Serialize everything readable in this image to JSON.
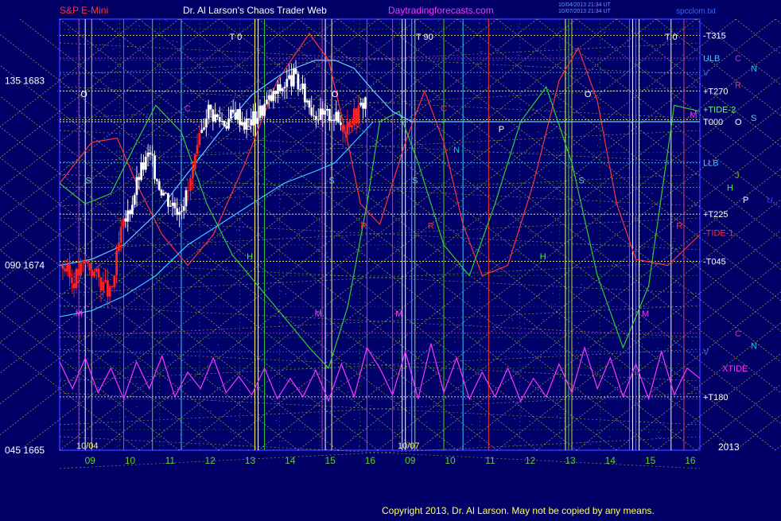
{
  "header": {
    "instrument": "S&P E-Mini",
    "site": "Dr. Al Larson's Chaos Trader Web",
    "url": "Daytradingforecasts.com",
    "stamp_line1": "10/04/2013 21:34 UT",
    "stamp_line2": "10/07/2013 21:34 UT",
    "file": "spcclom.txt"
  },
  "footer": {
    "copyright": "Copyright 2013, Dr. Al Larson. May not be copied by any means."
  },
  "chart_data": {
    "type": "line",
    "title": "Dr. Al Larson's Chaos Trader Web",
    "y_axis": {
      "ylim": [
        1665,
        1686
      ],
      "ticks": [
        {
          "value": 1683,
          "label": "135  1683"
        },
        {
          "value": 1674,
          "label": "090  1674"
        },
        {
          "value": 1665,
          "label": "045  1665"
        }
      ]
    },
    "x_axis": {
      "hour_labels": [
        "09",
        "10",
        "11",
        "12",
        "13",
        "14",
        "15",
        "16",
        "09",
        "10",
        "11",
        "12",
        "13",
        "14",
        "15",
        "16"
      ],
      "date_labels": [
        "10/04",
        "10/07"
      ],
      "year_label": "2013"
    },
    "right_labels": [
      {
        "text": "-T315",
        "color": "#ffffff",
        "value": 1685.2
      },
      {
        "text": "ULB",
        "color": "#33ccff",
        "value": 1684.1
      },
      {
        "text": "C",
        "color": "#cc33cc",
        "value": 1684.1,
        "col": 2
      },
      {
        "text": "N",
        "color": "#00cccc",
        "value": 1683.6,
        "col": 3
      },
      {
        "text": "V",
        "color": "#3366ff",
        "value": 1683.4
      },
      {
        "text": "R",
        "color": "#ff3333",
        "value": 1682.8,
        "col": 2
      },
      {
        "text": "+T270",
        "color": "#ffffff",
        "value": 1682.5
      },
      {
        "text": "+TIDE-2",
        "color": "#66ff66",
        "value": 1681.6
      },
      {
        "text": "S",
        "color": "#66cccc",
        "value": 1681.2,
        "col": 3
      },
      {
        "text": "T000",
        "color": "#ffffff",
        "value": 1681.0
      },
      {
        "text": "O",
        "color": "#ffffff",
        "value": 1681.0,
        "col": 2
      },
      {
        "text": "LLB",
        "color": "#33ccff",
        "value": 1679.0
      },
      {
        "text": "J",
        "color": "#66cc00",
        "value": 1678.4,
        "col": 2
      },
      {
        "text": "H",
        "color": "#33ff33",
        "value": 1677.8,
        "col": 1.5
      },
      {
        "text": "P",
        "color": "#ffffff",
        "value": 1677.2,
        "col": 2.5
      },
      {
        "text": "U",
        "color": "#3333ff",
        "value": 1677.2,
        "col": 4
      },
      {
        "text": "+T225",
        "color": "#ffffff",
        "value": 1676.5
      },
      {
        "text": "-TIDE-1",
        "color": "#ff3333",
        "value": 1675.6
      },
      {
        "text": "-T045",
        "color": "#ffffff",
        "value": 1674.2
      },
      {
        "text": "C",
        "color": "#cc33cc",
        "value": 1670.7,
        "col": 2
      },
      {
        "text": "N",
        "color": "#00cccc",
        "value": 1670.1,
        "col": 3
      },
      {
        "text": "V",
        "color": "#3366ff",
        "value": 1669.8
      },
      {
        "text": "XTIDE",
        "color": "#ff33ff",
        "value": 1669.0,
        "col": 1.2
      },
      {
        "text": "+T180",
        "color": "#ffffff",
        "value": 1667.6
      }
    ],
    "plot_letters": [
      {
        "text": "T  0",
        "color": "#ffffff",
        "x": 0.275,
        "value": 1685.0
      },
      {
        "text": "T  90",
        "color": "#ffffff",
        "x": 0.57,
        "value": 1685.0
      },
      {
        "text": "T  0",
        "color": "#ffffff",
        "x": 0.955,
        "value": 1685.0
      },
      {
        "text": "O",
        "color": "#ffffff",
        "x": 0.038,
        "value": 1682.2
      },
      {
        "text": "O",
        "color": "#ffffff",
        "x": 0.43,
        "value": 1682.2
      },
      {
        "text": "O",
        "color": "#ffffff",
        "x": 0.825,
        "value": 1682.2
      },
      {
        "text": "P",
        "color": "#ffffff",
        "x": 0.295,
        "value": 1680.5
      },
      {
        "text": "P",
        "color": "#ffffff",
        "x": 0.69,
        "value": 1680.5
      },
      {
        "text": "C",
        "color": "#cc33cc",
        "x": 0.2,
        "value": 1681.5
      },
      {
        "text": "C",
        "color": "#ff3333",
        "x": 0.6,
        "value": 1681.5
      },
      {
        "text": "N",
        "color": "#00cccc",
        "x": 0.62,
        "value": 1679.5
      },
      {
        "text": "S",
        "color": "#66cccc",
        "x": 0.045,
        "value": 1678.0
      },
      {
        "text": "S",
        "color": "#66cccc",
        "x": 0.425,
        "value": 1678.0
      },
      {
        "text": "S",
        "color": "#66cccc",
        "x": 0.555,
        "value": 1678.0
      },
      {
        "text": "S",
        "color": "#66cccc",
        "x": 0.815,
        "value": 1678.0
      },
      {
        "text": "R",
        "color": "#ff3333",
        "x": 0.475,
        "value": 1675.8
      },
      {
        "text": "R",
        "color": "#ff3333",
        "x": 0.58,
        "value": 1675.8
      },
      {
        "text": "R",
        "color": "#ff3333",
        "x": 0.968,
        "value": 1675.8
      },
      {
        "text": "H",
        "color": "#33ff33",
        "x": 0.297,
        "value": 1674.3
      },
      {
        "text": "H",
        "color": "#33ff33",
        "x": 0.755,
        "value": 1674.3
      },
      {
        "text": "M",
        "color": "#ff33ff",
        "x": 0.03,
        "value": 1671.5
      },
      {
        "text": "M",
        "color": "#ff33ff",
        "x": 0.404,
        "value": 1671.5
      },
      {
        "text": "M",
        "color": "#ff33ff",
        "x": 0.53,
        "value": 1671.5
      },
      {
        "text": "M",
        "color": "#ff33ff",
        "x": 0.915,
        "value": 1671.5
      },
      {
        "text": "M",
        "color": "#ff33ff",
        "x": 0.99,
        "value": 1681.2
      }
    ],
    "vertical_lines": [
      {
        "x": 0.03,
        "color": "#cc33cc"
      },
      {
        "x": 0.04,
        "color": "#ffffff"
      },
      {
        "x": 0.05,
        "color": "#cccc33"
      },
      {
        "x": 0.1,
        "color": "#ff3333"
      },
      {
        "x": 0.145,
        "color": "#66cc00"
      },
      {
        "x": 0.19,
        "color": "#33ccff"
      },
      {
        "x": 0.305,
        "color": "#ffff66"
      },
      {
        "x": 0.31,
        "color": "#ffffff"
      },
      {
        "x": 0.32,
        "color": "#33cc33"
      },
      {
        "x": 0.41,
        "color": "#cc33cc"
      },
      {
        "x": 0.415,
        "color": "#ffffff"
      },
      {
        "x": 0.425,
        "color": "#ffff66"
      },
      {
        "x": 0.48,
        "color": "#cc33cc"
      },
      {
        "x": 0.52,
        "color": "#ff3333"
      },
      {
        "x": 0.535,
        "color": "#ffffff"
      },
      {
        "x": 0.54,
        "color": "#ffffff"
      },
      {
        "x": 0.55,
        "color": "#33ccff"
      },
      {
        "x": 0.555,
        "color": "#cccc33"
      },
      {
        "x": 0.6,
        "color": "#66cc00"
      },
      {
        "x": 0.63,
        "color": "#33ccff"
      },
      {
        "x": 0.67,
        "color": "#ff3333"
      },
      {
        "x": 0.79,
        "color": "#ffff66"
      },
      {
        "x": 0.795,
        "color": "#33cc33"
      },
      {
        "x": 0.8,
        "color": "#cccc33"
      },
      {
        "x": 0.89,
        "color": "#cc33cc"
      },
      {
        "x": 0.895,
        "color": "#ffffff"
      },
      {
        "x": 0.9,
        "color": "#cc33cc"
      },
      {
        "x": 0.905,
        "color": "#ffffff"
      },
      {
        "x": 0.955,
        "color": "#ffff66"
      },
      {
        "x": 0.975,
        "color": "#ff3333"
      }
    ],
    "horizontal_lines": [
      {
        "value": 1685.2,
        "color": "#ffff66"
      },
      {
        "value": 1684.1,
        "color": "#cc33cc"
      },
      {
        "value": 1683.4,
        "color": "#33ccff"
      },
      {
        "value": 1682.5,
        "color": "#ffffff"
      },
      {
        "value": 1681.1,
        "color": "#ffff66"
      },
      {
        "value": 1681.0,
        "color": "#ffffff"
      },
      {
        "value": 1679.0,
        "color": "#33ccff"
      },
      {
        "value": 1677.8,
        "color": "#66cc00"
      },
      {
        "value": 1676.5,
        "color": "#ffff66"
      },
      {
        "value": 1674.2,
        "color": "#ffff66"
      },
      {
        "value": 1670.7,
        "color": "#cc33cc"
      },
      {
        "value": 1669.8,
        "color": "#3366ff"
      },
      {
        "value": 1667.6,
        "color": "#ffffff"
      }
    ],
    "series": [
      {
        "color": "#ff3333",
        "x": [
          0,
          0.05,
          0.09,
          0.12,
          0.16,
          0.2,
          0.24,
          0.29,
          0.34,
          0.39,
          0.42,
          0.45,
          0.47,
          0.5,
          0.54,
          0.57,
          0.6,
          0.63,
          0.66,
          0.7,
          0.74,
          0.78,
          0.81,
          0.84,
          0.87,
          0.9,
          0.95,
          1.0
        ],
        "y": [
          1678.0,
          1680.0,
          1680.2,
          1678.0,
          1675.5,
          1674.0,
          1675.5,
          1679.0,
          1683.0,
          1685.3,
          1684.0,
          1680.0,
          1677.0,
          1676.0,
          1680.0,
          1682.5,
          1680.0,
          1676.0,
          1673.5,
          1674.0,
          1678.0,
          1683.0,
          1684.6,
          1682.0,
          1677.0,
          1674.3,
          1674.0,
          1675.5
        ]
      },
      {
        "color": "#33cc33",
        "x": [
          0,
          0.04,
          0.08,
          0.12,
          0.15,
          0.19,
          0.23,
          0.27,
          0.31,
          0.35,
          0.39,
          0.42,
          0.45,
          0.48,
          0.5,
          0.53,
          0.56,
          0.6,
          0.64,
          0.68,
          0.72,
          0.76,
          0.8,
          0.84,
          0.88,
          0.92,
          0.96,
          1.0
        ],
        "y": [
          1678.0,
          1677.0,
          1677.5,
          1680.0,
          1681.8,
          1680.5,
          1677.0,
          1674.5,
          1673.0,
          1671.5,
          1670.0,
          1669.0,
          1672.0,
          1677.0,
          1681.0,
          1681.5,
          1679.0,
          1675.0,
          1673.5,
          1677.0,
          1681.0,
          1682.7,
          1679.0,
          1673.5,
          1670.0,
          1673.0,
          1681.8,
          1681.5
        ]
      },
      {
        "color": "#66ccff",
        "x": [
          0,
          0.05,
          0.1,
          0.15,
          0.2,
          0.25,
          0.3,
          0.35,
          0.4,
          0.43,
          0.46,
          0.49,
          0.52,
          0.55,
          0.58,
          0.62,
          0.66,
          0.7,
          0.74,
          0.78,
          0.82,
          0.86,
          0.9,
          0.94,
          1.0
        ],
        "y": [
          1674.0,
          1674.3,
          1675.0,
          1676.5,
          1678.5,
          1680.5,
          1682.3,
          1683.4,
          1684.0,
          1684.0,
          1683.6,
          1682.5,
          1681.5,
          1681.0,
          1681.0,
          1681.0,
          1681.0,
          1681.0,
          1681.0,
          1681.0,
          1681.0,
          1681.0,
          1681.0,
          1681.0,
          1681.0
        ]
      },
      {
        "color": "#33ccff",
        "x": [
          0,
          0.05,
          0.1,
          0.15,
          0.2,
          0.25,
          0.3,
          0.35,
          0.4,
          0.43,
          0.46,
          0.49
        ],
        "y": [
          1671.5,
          1671.8,
          1672.5,
          1673.5,
          1675.0,
          1676.0,
          1677.0,
          1678.0,
          1678.6,
          1679.0,
          1680.0,
          1681.0
        ]
      },
      {
        "color": "#ff33ff",
        "x": [
          0,
          0.02,
          0.04,
          0.06,
          0.08,
          0.1,
          0.12,
          0.14,
          0.16,
          0.18,
          0.2,
          0.22,
          0.24,
          0.26,
          0.28,
          0.3,
          0.32,
          0.34,
          0.36,
          0.38,
          0.4,
          0.42,
          0.44,
          0.46,
          0.48,
          0.5,
          0.52,
          0.54,
          0.56,
          0.58,
          0.6,
          0.62,
          0.64,
          0.66,
          0.68,
          0.7,
          0.72,
          0.74,
          0.76,
          0.78,
          0.8,
          0.82,
          0.84,
          0.86,
          0.88,
          0.9,
          0.92,
          0.94,
          0.96,
          0.98,
          1.0
        ],
        "y": [
          1669.3,
          1668.0,
          1669.5,
          1667.8,
          1669.0,
          1667.5,
          1669.3,
          1668.0,
          1669.6,
          1667.6,
          1668.8,
          1668.0,
          1669.5,
          1667.8,
          1668.6,
          1667.7,
          1669.0,
          1667.5,
          1668.5,
          1667.6,
          1668.9,
          1667.4,
          1669.2,
          1667.6,
          1670.0,
          1669.0,
          1667.7,
          1669.8,
          1667.5,
          1670.2,
          1667.8,
          1669.5,
          1667.5,
          1668.8,
          1667.6,
          1669.0,
          1667.4,
          1668.5,
          1667.6,
          1669.2,
          1667.8,
          1670.0,
          1668.0,
          1669.5,
          1667.6,
          1669.2,
          1667.5,
          1669.8,
          1667.7,
          1669.0,
          1668.5
        ]
      }
    ],
    "price_path": {
      "x": [
        0.005,
        0.02,
        0.04,
        0.06,
        0.08,
        0.095,
        0.11,
        0.125,
        0.14,
        0.155,
        0.17,
        0.185,
        0.2,
        0.215,
        0.23,
        0.245,
        0.26,
        0.275,
        0.29,
        0.305,
        0.32,
        0.335,
        0.35,
        0.365,
        0.38,
        0.395,
        0.41,
        0.425,
        0.435,
        0.445,
        0.455,
        0.465,
        0.48
      ],
      "y": [
        1674.0,
        1673.2,
        1674.2,
        1673.4,
        1672.5,
        1675.5,
        1676.8,
        1678.5,
        1679.4,
        1678.0,
        1677.2,
        1676.8,
        1677.5,
        1679.5,
        1681.7,
        1681.2,
        1681.0,
        1681.5,
        1680.9,
        1681.2,
        1681.8,
        1682.3,
        1682.8,
        1683.2,
        1682.4,
        1681.6,
        1681.2,
        1681.4,
        1681.0,
        1680.8,
        1681.2,
        1681.4,
        1682.3
      ]
    }
  }
}
